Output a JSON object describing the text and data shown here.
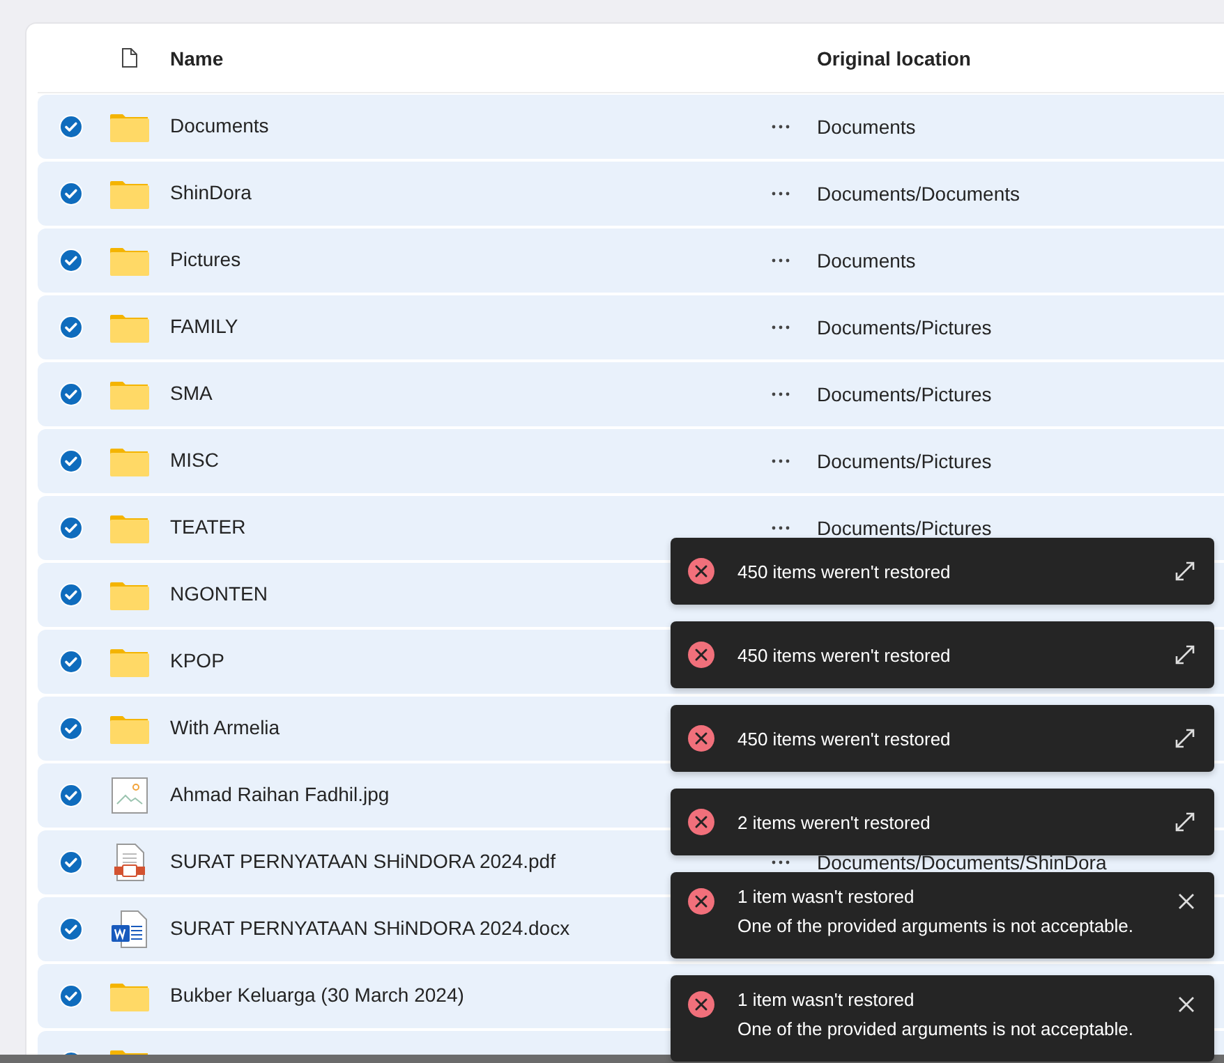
{
  "table": {
    "columns": [
      "Name",
      "Original location"
    ],
    "rows": [
      {
        "kind": "folder",
        "name": "Documents",
        "location": "Documents",
        "selected": true,
        "more": true
      },
      {
        "kind": "folder",
        "name": "ShinDora",
        "location": "Documents/Documents",
        "selected": true,
        "more": true
      },
      {
        "kind": "folder",
        "name": "Pictures",
        "location": "Documents",
        "selected": true,
        "more": true
      },
      {
        "kind": "folder",
        "name": "FAMILY",
        "location": "Documents/Pictures",
        "selected": true,
        "more": true
      },
      {
        "kind": "folder",
        "name": "SMA",
        "location": "Documents/Pictures",
        "selected": true,
        "more": true
      },
      {
        "kind": "folder",
        "name": "MISC",
        "location": "Documents/Pictures",
        "selected": true,
        "more": true
      },
      {
        "kind": "folder",
        "name": "TEATER",
        "location": "Documents/Pictures",
        "selected": true,
        "more": true
      },
      {
        "kind": "folder",
        "name": "NGONTEN",
        "selected": true,
        "more": false
      },
      {
        "kind": "folder",
        "name": "KPOP",
        "selected": true,
        "more": false
      },
      {
        "kind": "folder",
        "name": "With Armelia",
        "selected": true,
        "more": false
      },
      {
        "kind": "image",
        "name": "Ahmad Raihan Fadhil.jpg",
        "selected": true,
        "more": false
      },
      {
        "kind": "pdf",
        "name": "SURAT PERNYATAAN SHiNDORA 2024.pdf",
        "location": "Documents/Documents/ShinDora",
        "selected": true,
        "more": true
      },
      {
        "kind": "word",
        "name": "SURAT PERNYATAAN SHiNDORA 2024.docx",
        "selected": true,
        "more": false
      },
      {
        "kind": "folder",
        "name": "Bukber Keluarga (30 March 2024)",
        "selected": true,
        "more": false
      },
      {
        "kind": "folder",
        "selected": true,
        "more": false
      }
    ]
  },
  "toasts": [
    {
      "kind": "expand",
      "title": "450 items weren't restored"
    },
    {
      "kind": "expand",
      "title": "450 items weren't restored"
    },
    {
      "kind": "expand",
      "title": "450 items weren't restored"
    },
    {
      "kind": "expand",
      "title": "2 items weren't restored"
    },
    {
      "kind": "close",
      "title": "1 item wasn't restored",
      "message": "One of the provided arguments is not acceptable."
    },
    {
      "kind": "close",
      "title": "1 item wasn't restored",
      "message": "One of the provided arguments is not acceptable."
    }
  ]
}
